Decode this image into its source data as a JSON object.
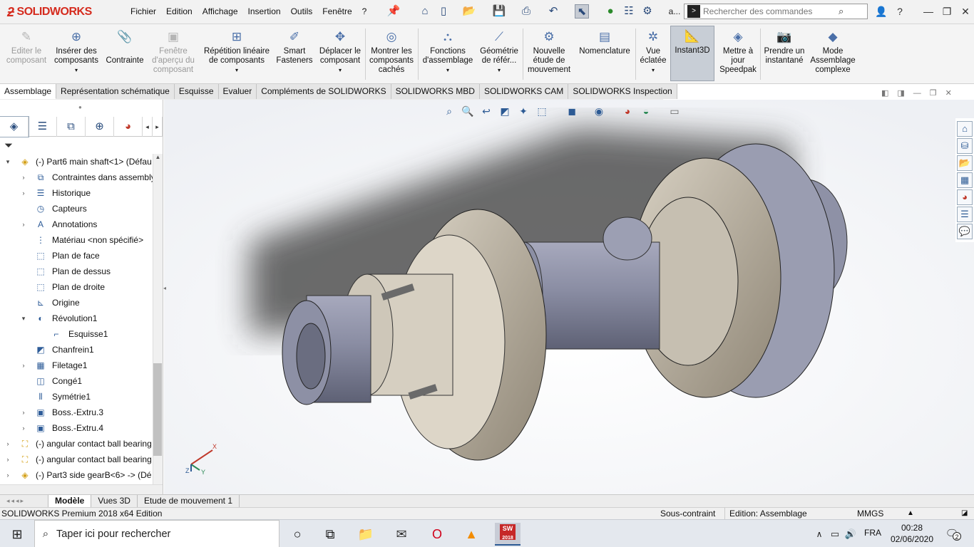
{
  "app": {
    "brand": "SOLIDWORKS",
    "brand_color": "#d52b1e"
  },
  "menubar": {
    "items": [
      "Fichier",
      "Edition",
      "Affichage",
      "Insertion",
      "Outils",
      "Fenêtre",
      "?"
    ],
    "pin_icon": "pin-icon"
  },
  "quick_access": {
    "icons": [
      "home-icon",
      "new-document-icon",
      "open-icon",
      "save-icon",
      "print-icon",
      "undo-icon",
      "select-arrow-icon",
      "rebuild-traffic-light-icon",
      "file-properties-icon",
      "options-gear-icon"
    ],
    "more_text": "a..."
  },
  "search": {
    "placeholder": "Rechercher des commandes"
  },
  "window_controls": {
    "user_icon": "user-icon",
    "help_text": "?",
    "minimize": "minimize-icon",
    "restore": "restore-icon",
    "close": "close-icon"
  },
  "commands": [
    {
      "label": "Editer le composant",
      "icon": "edit-component-icon",
      "disabled": true
    },
    {
      "label": "Insérer des composants",
      "icon": "insert-components-icon",
      "disabled": false
    },
    {
      "label": "Contrainte",
      "icon": "mate-paperclip-icon",
      "disabled": false
    },
    {
      "label": "Fenêtre d'aperçu du composant",
      "icon": "component-preview-icon",
      "disabled": true
    },
    {
      "label": "Répétition linéaire de composants",
      "icon": "linear-pattern-icon",
      "disabled": false
    },
    {
      "label": "Smart Fasteners",
      "icon": "smart-fasteners-icon",
      "disabled": false
    },
    {
      "label": "Déplacer le composant",
      "icon": "move-component-icon",
      "disabled": false
    },
    {
      "label": "Montrer les composants cachés",
      "icon": "show-hidden-icon",
      "disabled": false
    },
    {
      "label": "Fonctions d'assemblage",
      "icon": "assembly-features-icon",
      "disabled": false
    },
    {
      "label": "Géométrie de référ...",
      "icon": "reference-geometry-icon",
      "disabled": false
    },
    {
      "label": "Nouvelle étude de mouvement",
      "icon": "motion-study-icon",
      "disabled": false
    },
    {
      "label": "Nomenclature",
      "icon": "bom-icon",
      "disabled": false
    },
    {
      "label": "Vue éclatée",
      "icon": "exploded-view-icon",
      "disabled": false
    },
    {
      "label": "Instant3D",
      "icon": "instant3d-icon",
      "disabled": false,
      "active": true
    },
    {
      "label": "Mettre à jour Speedpak",
      "icon": "speedpak-icon",
      "disabled": false
    },
    {
      "label": "Prendre un instantané",
      "icon": "camera-icon",
      "disabled": false
    },
    {
      "label": "Mode Assemblage complexe",
      "icon": "large-assembly-icon",
      "disabled": false
    }
  ],
  "tabs": [
    "Assemblage",
    "Représentation schématique",
    "Esquisse",
    "Evaluer",
    "Compléments de SOLIDWORKS",
    "SOLIDWORKS MBD",
    "SOLIDWORKS CAM",
    "SOLIDWORKS Inspection"
  ],
  "active_tab": "Assemblage",
  "panel_tabs": [
    "featuremanager-icon",
    "propertymanager-icon",
    "configurationmanager-icon",
    "dimxpert-icon",
    "display-manager-icon"
  ],
  "tree": [
    {
      "label": "(-) Part6 main shaft<1> (Défau",
      "level": 0,
      "expander": "expanded",
      "icon": "part-icon"
    },
    {
      "label": "Contraintes dans assembly",
      "level": 1,
      "expander": "collapsed",
      "icon": "mates-folder-icon"
    },
    {
      "label": "Historique",
      "level": 1,
      "expander": "collapsed",
      "icon": "history-icon"
    },
    {
      "label": "Capteurs",
      "level": 1,
      "expander": "none",
      "icon": "sensor-icon"
    },
    {
      "label": "Annotations",
      "level": 1,
      "expander": "collapsed",
      "icon": "annotation-icon"
    },
    {
      "label": "Matériau <non spécifié>",
      "level": 1,
      "expander": "none",
      "icon": "material-icon"
    },
    {
      "label": "Plan de face",
      "level": 1,
      "expander": "none",
      "icon": "plane-icon"
    },
    {
      "label": "Plan de dessus",
      "level": 1,
      "expander": "none",
      "icon": "plane-icon"
    },
    {
      "label": "Plan de droite",
      "level": 1,
      "expander": "none",
      "icon": "plane-icon"
    },
    {
      "label": "Origine",
      "level": 1,
      "expander": "none",
      "icon": "origin-icon"
    },
    {
      "label": "Révolution1",
      "level": 1,
      "expander": "expanded",
      "icon": "revolve-icon"
    },
    {
      "label": "Esquisse1",
      "level": 2,
      "expander": "none",
      "icon": "sketch-icon"
    },
    {
      "label": "Chanfrein1",
      "level": 1,
      "expander": "none",
      "icon": "chamfer-icon"
    },
    {
      "label": "Filetage1",
      "level": 1,
      "expander": "collapsed",
      "icon": "thread-icon"
    },
    {
      "label": "Congé1",
      "level": 1,
      "expander": "none",
      "icon": "fillet-icon"
    },
    {
      "label": "Symétrie1",
      "level": 1,
      "expander": "none",
      "icon": "mirror-icon"
    },
    {
      "label": "Boss.-Extru.3",
      "level": 1,
      "expander": "collapsed",
      "icon": "extrude-icon"
    },
    {
      "label": "Boss.-Extru.4",
      "level": 1,
      "expander": "collapsed",
      "icon": "extrude-icon"
    },
    {
      "label": "(-) angular contact ball bearing",
      "level": 0,
      "expander": "collapsed",
      "icon": "part-bearing-icon"
    },
    {
      "label": "(-) angular contact ball bearing",
      "level": 0,
      "expander": "collapsed",
      "icon": "part-bearing-icon"
    },
    {
      "label": "(-) Part3 side gearB<6> -> (Dé",
      "level": 0,
      "expander": "collapsed",
      "icon": "part-icon"
    }
  ],
  "bottom_tabs": [
    "Modèle",
    "Vues 3D",
    "Etude de mouvement 1"
  ],
  "active_bottom_tab": "Modèle",
  "status": {
    "edition": "SOLIDWORKS Premium 2018 x64 Edition",
    "constraint": "Sous-contraint",
    "mode": "Edition: Assemblage",
    "units": "MMGS"
  },
  "taskbar": {
    "search_text": "Taper ici pour rechercher",
    "language": "FRA",
    "time": "00:28",
    "date": "02/06/2020",
    "notification_count": "2",
    "app_badge": "2018"
  },
  "triad": {
    "x": "X",
    "y": "Y",
    "z": "Z"
  },
  "colors": {
    "accent": "#2c5a94",
    "part_gray": "#8c8fa3",
    "gear_bronze": "#b8ad9a"
  }
}
